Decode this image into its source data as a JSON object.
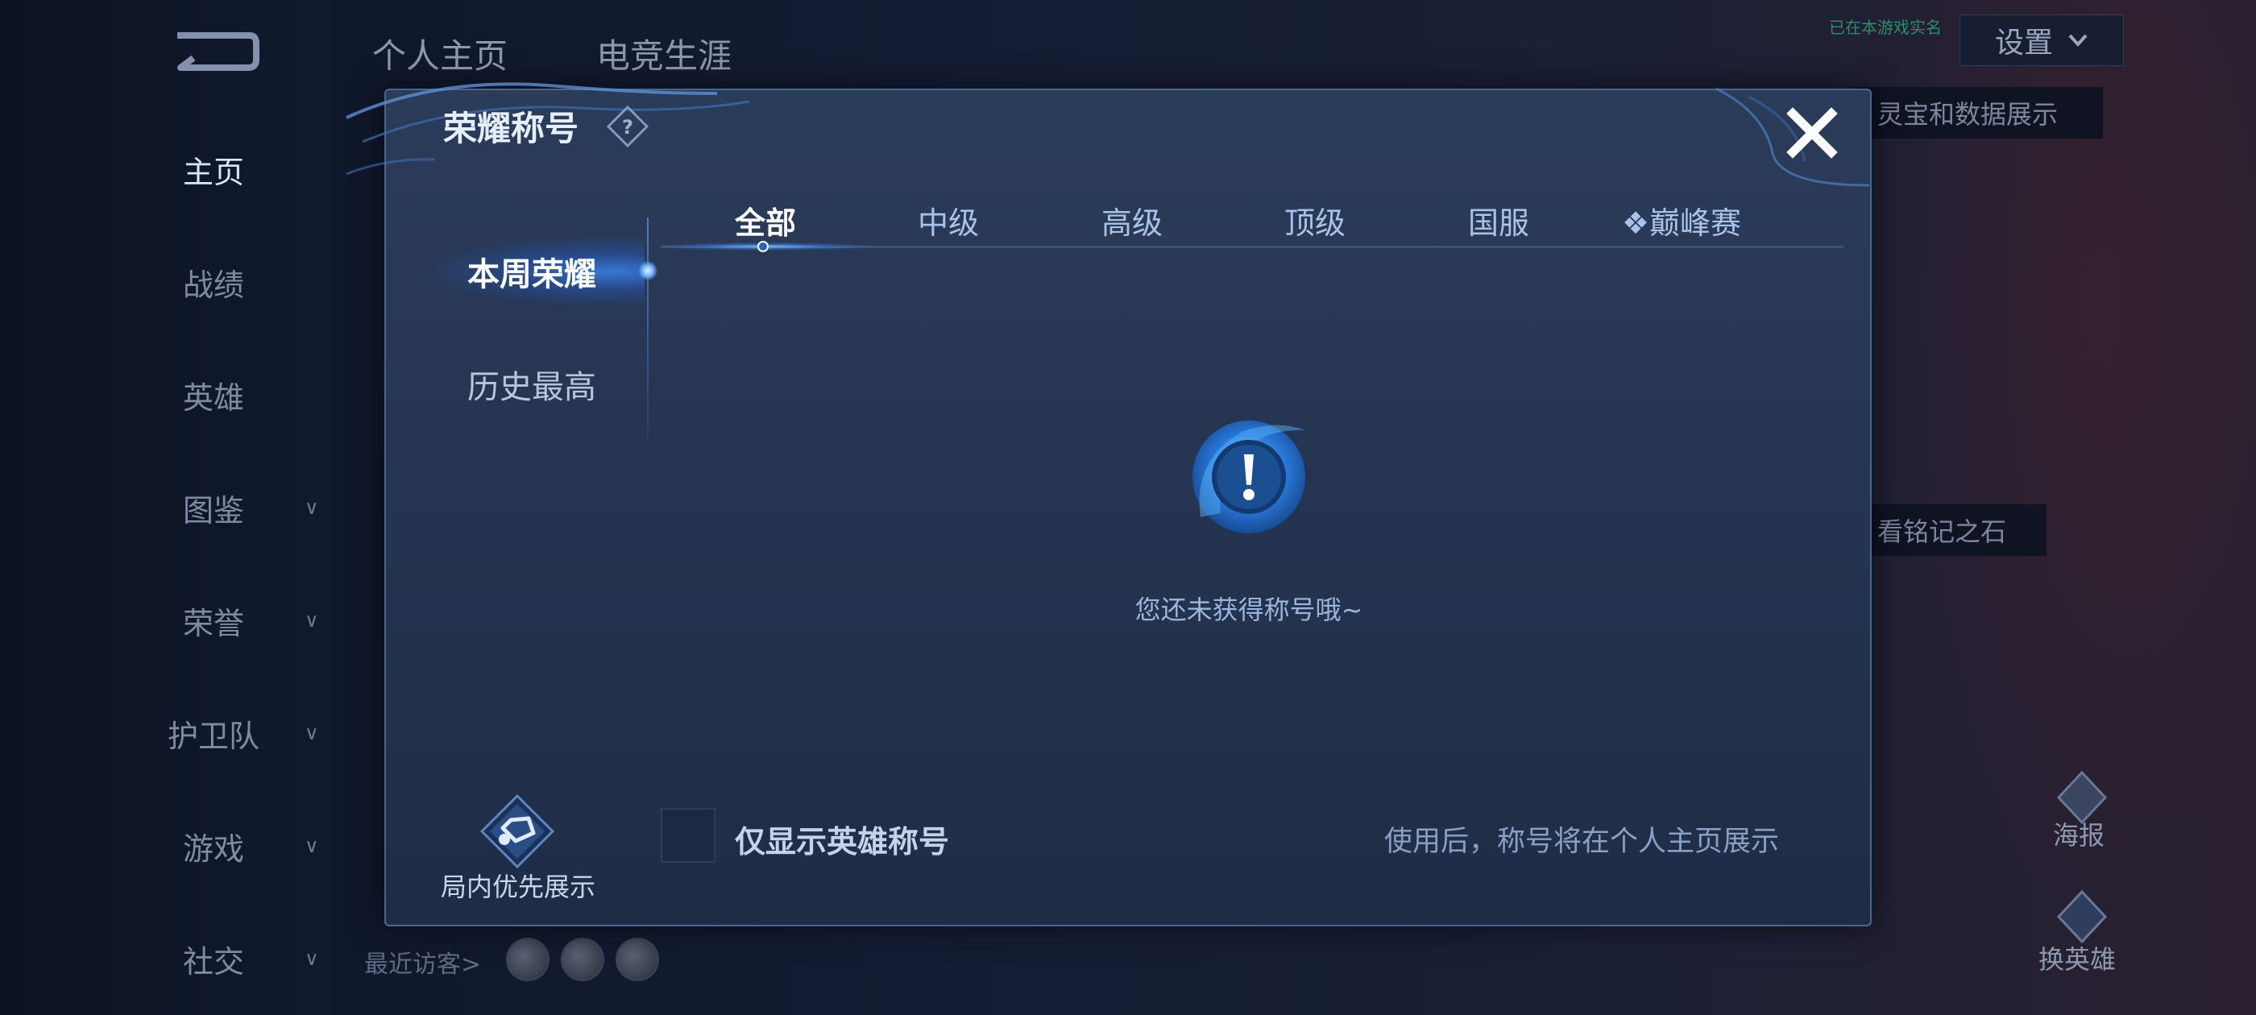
{
  "background": {
    "nav": [
      {
        "label": "主页",
        "active": true,
        "chevron": false
      },
      {
        "label": "战绩",
        "active": false,
        "chevron": false
      },
      {
        "label": "英雄",
        "active": false,
        "chevron": false
      },
      {
        "label": "图鉴",
        "active": false,
        "chevron": true
      },
      {
        "label": "荣誉",
        "active": false,
        "chevron": true
      },
      {
        "label": "护卫队",
        "active": false,
        "chevron": true
      },
      {
        "label": "游戏",
        "active": false,
        "chevron": true
      },
      {
        "label": "社交",
        "active": false,
        "chevron": true
      }
    ],
    "top_tabs": [
      "个人主页",
      "电竞生涯"
    ],
    "settings_label": "设置",
    "tiny_tag": "已在本游戏实名",
    "right_banner": "灵宝和数据展示",
    "right_banner2": "看铭记之石",
    "poster_label": "海报",
    "change_hero_label": "换英雄",
    "visitors_label": "最近访客>"
  },
  "modal": {
    "title": "荣耀称号",
    "side_tabs": [
      {
        "label": "本周荣耀",
        "active": true
      },
      {
        "label": "历史最高",
        "active": false
      }
    ],
    "tabs": [
      {
        "label": "全部",
        "active": true
      },
      {
        "label": "中级",
        "active": false
      },
      {
        "label": "高级",
        "active": false
      },
      {
        "label": "顶级",
        "active": false
      },
      {
        "label": "国服",
        "active": false
      },
      {
        "label": "❖巅峰赛",
        "active": false
      }
    ],
    "empty_text": "您还未获得称号哦~",
    "priority_label": "局内优先展示",
    "checkbox_label": "仅显示英雄称号",
    "checkbox_checked": false,
    "hint": "使用后，称号将在个人主页展示"
  },
  "colors": {
    "accent": "#3c8cff",
    "modal_bg": "#26354f",
    "text_primary": "#e6eefc"
  }
}
